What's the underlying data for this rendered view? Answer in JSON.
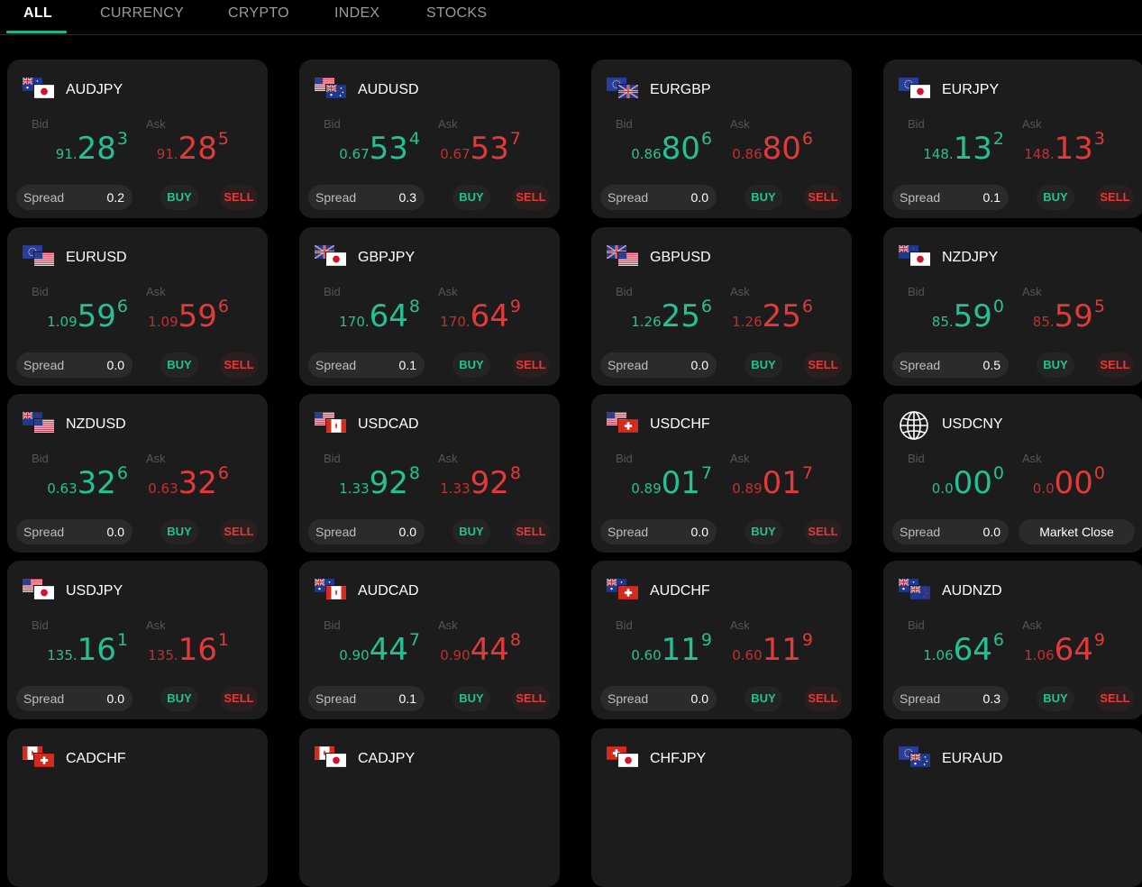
{
  "tabs": [
    {
      "label": "ALL",
      "active": true
    },
    {
      "label": "CURRENCY",
      "active": false
    },
    {
      "label": "CRYPTO",
      "active": false
    },
    {
      "label": "INDEX",
      "active": false
    },
    {
      "label": "STOCKS",
      "active": false
    }
  ],
  "labels": {
    "bid": "Bid",
    "ask": "Ask",
    "spread": "Spread",
    "buy": "BUY",
    "sell": "SELL"
  },
  "colors": {
    "bid": "#23c194",
    "ask": "#e23a3a",
    "card": "#1c1c1c",
    "accent": "#1fb58a"
  },
  "instruments": [
    {
      "symbol": "AUDJPY",
      "flags": [
        "au",
        "jp"
      ],
      "bid": {
        "prefix": "91.",
        "main": "28",
        "sup": "3"
      },
      "ask": {
        "prefix": "91.",
        "main": "28",
        "sup": "5"
      },
      "spread": "0.2"
    },
    {
      "symbol": "AUDUSD",
      "flags": [
        "us",
        "au"
      ],
      "bid": {
        "prefix": "0.67",
        "main": "53",
        "sup": "4"
      },
      "ask": {
        "prefix": "0.67",
        "main": "53",
        "sup": "7"
      },
      "spread": "0.3"
    },
    {
      "symbol": "EURGBP",
      "flags": [
        "eu",
        "gb"
      ],
      "bid": {
        "prefix": "0.86",
        "main": "80",
        "sup": "6"
      },
      "ask": {
        "prefix": "0.86",
        "main": "80",
        "sup": "6"
      },
      "spread": "0.0"
    },
    {
      "symbol": "EURJPY",
      "flags": [
        "eu",
        "jp"
      ],
      "bid": {
        "prefix": "148.",
        "main": "13",
        "sup": "2"
      },
      "ask": {
        "prefix": "148.",
        "main": "13",
        "sup": "3"
      },
      "spread": "0.1"
    },
    {
      "symbol": "EURUSD",
      "flags": [
        "eu",
        "us"
      ],
      "bid": {
        "prefix": "1.09",
        "main": "59",
        "sup": "6"
      },
      "ask": {
        "prefix": "1.09",
        "main": "59",
        "sup": "6"
      },
      "spread": "0.0"
    },
    {
      "symbol": "GBPJPY",
      "flags": [
        "gb",
        "jp"
      ],
      "bid": {
        "prefix": "170.",
        "main": "64",
        "sup": "8"
      },
      "ask": {
        "prefix": "170.",
        "main": "64",
        "sup": "9"
      },
      "spread": "0.1"
    },
    {
      "symbol": "GBPUSD",
      "flags": [
        "gb",
        "us"
      ],
      "bid": {
        "prefix": "1.26",
        "main": "25",
        "sup": "6"
      },
      "ask": {
        "prefix": "1.26",
        "main": "25",
        "sup": "6"
      },
      "spread": "0.0"
    },
    {
      "symbol": "NZDJPY",
      "flags": [
        "nz",
        "jp"
      ],
      "bid": {
        "prefix": "85.",
        "main": "59",
        "sup": "0"
      },
      "ask": {
        "prefix": "85.",
        "main": "59",
        "sup": "5"
      },
      "spread": "0.5"
    },
    {
      "symbol": "NZDUSD",
      "flags": [
        "nz",
        "us"
      ],
      "bid": {
        "prefix": "0.63",
        "main": "32",
        "sup": "6"
      },
      "ask": {
        "prefix": "0.63",
        "main": "32",
        "sup": "6"
      },
      "spread": "0.0"
    },
    {
      "symbol": "USDCAD",
      "flags": [
        "us",
        "ca"
      ],
      "bid": {
        "prefix": "1.33",
        "main": "92",
        "sup": "8"
      },
      "ask": {
        "prefix": "1.33",
        "main": "92",
        "sup": "8"
      },
      "spread": "0.0"
    },
    {
      "symbol": "USDCHF",
      "flags": [
        "us",
        "ch"
      ],
      "bid": {
        "prefix": "0.89",
        "main": "01",
        "sup": "7"
      },
      "ask": {
        "prefix": "0.89",
        "main": "01",
        "sup": "7"
      },
      "spread": "0.0"
    },
    {
      "symbol": "USDCNY",
      "flags": [
        "globe"
      ],
      "bid": {
        "prefix": "0.0",
        "main": "00",
        "sup": "0"
      },
      "ask": {
        "prefix": "0.0",
        "main": "00",
        "sup": "0"
      },
      "spread": "0.0",
      "status": "Market Close"
    },
    {
      "symbol": "USDJPY",
      "flags": [
        "us",
        "jp"
      ],
      "bid": {
        "prefix": "135.",
        "main": "16",
        "sup": "1"
      },
      "ask": {
        "prefix": "135.",
        "main": "16",
        "sup": "1"
      },
      "spread": "0.0"
    },
    {
      "symbol": "AUDCAD",
      "flags": [
        "au",
        "ca"
      ],
      "bid": {
        "prefix": "0.90",
        "main": "44",
        "sup": "7"
      },
      "ask": {
        "prefix": "0.90",
        "main": "44",
        "sup": "8"
      },
      "spread": "0.1"
    },
    {
      "symbol": "AUDCHF",
      "flags": [
        "au",
        "ch"
      ],
      "bid": {
        "prefix": "0.60",
        "main": "11",
        "sup": "9"
      },
      "ask": {
        "prefix": "0.60",
        "main": "11",
        "sup": "9"
      },
      "spread": "0.0"
    },
    {
      "symbol": "AUDNZD",
      "flags": [
        "au",
        "nz"
      ],
      "bid": {
        "prefix": "1.06",
        "main": "64",
        "sup": "6"
      },
      "ask": {
        "prefix": "1.06",
        "main": "64",
        "sup": "9"
      },
      "spread": "0.3"
    },
    {
      "symbol": "CADCHF",
      "flags": [
        "ca",
        "ch"
      ]
    },
    {
      "symbol": "CADJPY",
      "flags": [
        "ca",
        "jp"
      ]
    },
    {
      "symbol": "CHFJPY",
      "flags": [
        "ch",
        "jp"
      ]
    },
    {
      "symbol": "EURAUD",
      "flags": [
        "eu",
        "au"
      ]
    }
  ]
}
